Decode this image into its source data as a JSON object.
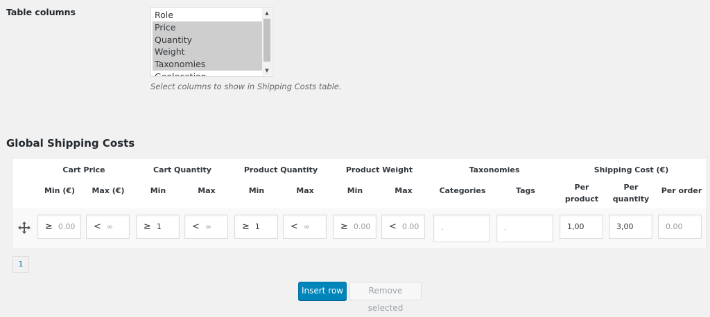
{
  "table_columns": {
    "label": "Table columns",
    "options": [
      {
        "label": "Role",
        "selected": false
      },
      {
        "label": "Price",
        "selected": true
      },
      {
        "label": "Quantity",
        "selected": true
      },
      {
        "label": "Weight",
        "selected": true
      },
      {
        "label": "Taxonomies",
        "selected": true
      },
      {
        "label": "Geolocation",
        "selected": false
      }
    ],
    "hint": "Select columns to show in Shipping Costs table."
  },
  "global_shipping": {
    "title": "Global Shipping Costs",
    "groups": {
      "cart_price": "Cart Price",
      "cart_quantity": "Cart Quantity",
      "product_quantity": "Product Quantity",
      "product_weight": "Product Weight",
      "taxonomies": "Taxonomies",
      "shipping_cost": "Shipping Cost (€)"
    },
    "columns": {
      "cart_price_min": "Min (€)",
      "cart_price_max": "Max (€)",
      "cart_qty_min": "Min",
      "cart_qty_max": "Max",
      "prod_qty_min": "Min",
      "prod_qty_max": "Max",
      "prod_weight_min": "Min",
      "prod_weight_max": "Max",
      "categories": "Categories",
      "tags": "Tags",
      "per_product": "Per product",
      "per_quantity": "Per quantity",
      "per_order": "Per order"
    },
    "row": {
      "cart_price_min": {
        "op": "≥",
        "value": "0.00"
      },
      "cart_price_max": {
        "op": "<",
        "value": "∞"
      },
      "cart_qty_min": {
        "op": "≥",
        "value": "1"
      },
      "cart_qty_max": {
        "op": "<",
        "value": "∞"
      },
      "prod_qty_min": {
        "op": "≥",
        "value": "1"
      },
      "prod_qty_max": {
        "op": "<",
        "value": "∞"
      },
      "prod_weight_min": {
        "op": "≥",
        "value": "0.00"
      },
      "prod_weight_max": {
        "op": "<",
        "value": "0.00"
      },
      "categories": ".",
      "tags": ".",
      "per_product": "1,00",
      "per_quantity": "3,00",
      "per_order": "0.00"
    },
    "pagination": {
      "current_page": "1"
    },
    "buttons": {
      "insert": "Insert row",
      "remove": "Remove selected"
    }
  },
  "colors": {
    "primary": "#0085ba",
    "selected_option": "#cecece",
    "background": "#f1f1f1"
  },
  "icons": {
    "move": "move-arrows-icon"
  }
}
